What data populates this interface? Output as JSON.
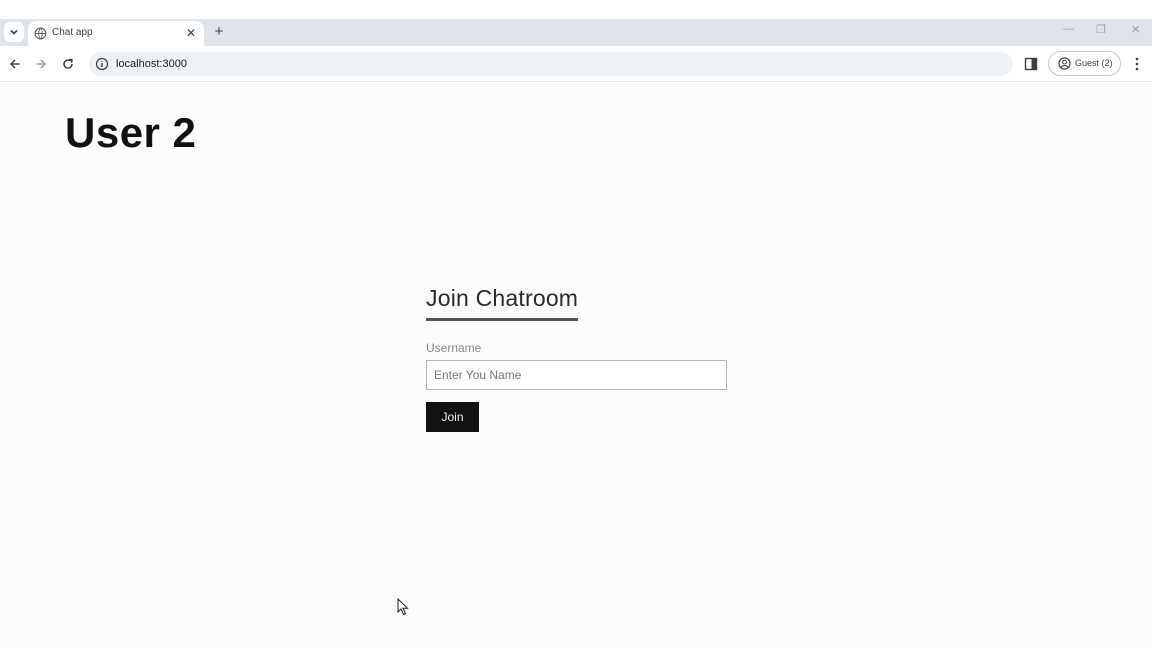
{
  "browser": {
    "tab": {
      "title": "Chat app",
      "close_glyph": "✕"
    },
    "new_tab_glyph": "+",
    "window_controls": {
      "minimize": "—",
      "restore": "❐",
      "close": "✕"
    },
    "address_bar": {
      "url": "localhost:3000"
    },
    "profile": {
      "label": "Guest (2)"
    }
  },
  "page": {
    "heading": "User 2",
    "form": {
      "title": "Join Chatroom",
      "username_label": "Username",
      "username_placeholder": "Enter You Name",
      "username_value": "",
      "join_label": "Join"
    }
  },
  "colors": {
    "tabbar_bg": "#dfe3ea",
    "omnibox_bg": "#eef1f6",
    "button_bg": "#121212",
    "heading_text": "#111111"
  }
}
